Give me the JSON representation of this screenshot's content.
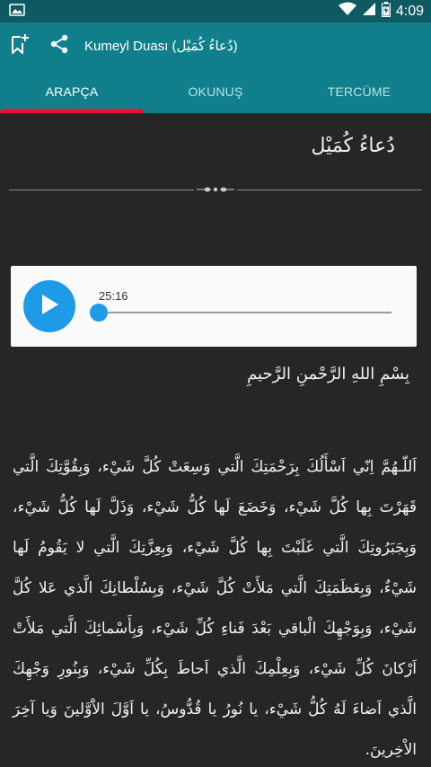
{
  "status_bar": {
    "time": "4:09",
    "battery_level": 0.75,
    "icons": [
      "picture-icon",
      "wifi-icon",
      "signal-icon",
      "battery-icon"
    ]
  },
  "app_bar": {
    "title": "Kumeyl Duası (دُعاءُ كُمَيْل)",
    "icons": [
      "bookmark-add-icon",
      "share-icon"
    ]
  },
  "tabs": [
    {
      "label": "ARAPÇA",
      "active": true
    },
    {
      "label": "OKUNUŞ",
      "active": false
    },
    {
      "label": "TERCÜME",
      "active": false
    }
  ],
  "content": {
    "title": "دُعاءُ كُمَيْل",
    "player": {
      "duration": "25:16",
      "progress": 0.0
    },
    "basmala": "بِسْمِ اللهِ الرَّحْمنِ الرَّحيمِ",
    "body": "اَللّـهُمَّ اِنّي اَسْأَلُكَ بِرَحْمَتِكَ الَّتي وَسِعَتْ كُلَّ شَيْء، وَبِقُوَّتِكَ الَّتي قَهَرْتَ بِها كُلَّ شَيْء، وَخَضَعَ لَها كُلُّ شَيْء، وَذَلَّ لَها كُلُّ شَيْء، وَبِجَبَرُوتِكَ الَّتي غَلَبْتَ بِها كُلَّ شَيْء، وَبِعِزَّتِكَ الَّتي لا يَقُومُ لَها شَيْءٌ، وَبِعَظَمَتِكَ الَّتي مَلأَتْ كُلَّ شَيْء، وَبِسُلْطانِكَ الَّذي عَلا كُلَّ شَيْء، وَبِوَجْهِكَ الْباقي بَعْدَ فَناءِ كُلِّ شَيْء، وَبِأَسْمائِكَ الَّتي مَلأَتْ اَرْكانَ كُلِّ شَيْء، وَبِعِلْمِكَ الَّذي اَحاطَ بِكُلِّ شَيْء، وَبِنُورِ وَجْهِكَ الَّذي اَضاءَ لَهُ كُلُّ شَيْء، يا نُورُ يا قُدُّوسُ، يا اَوَّلَ الاَْوَّلينَ وَيا آخِرَ الاْخِرينَ."
  }
}
